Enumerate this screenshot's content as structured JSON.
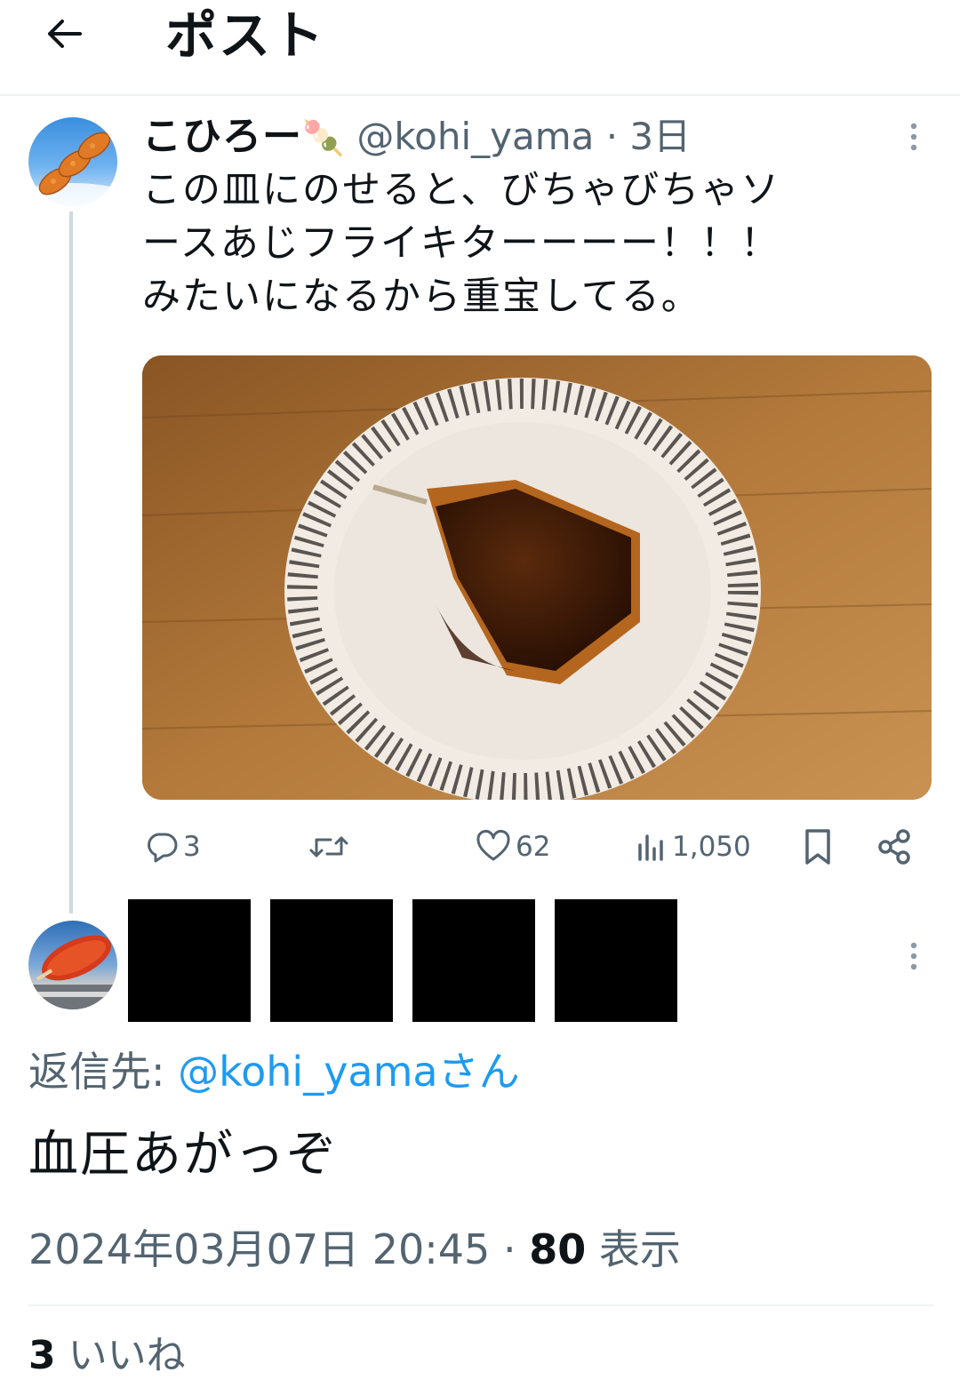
{
  "header": {
    "title": "ポスト"
  },
  "tweet": {
    "author_name": "こひろー",
    "author_emoji": "🍡",
    "handle_and_time": "@kohi_yama · 3日",
    "text_lines": [
      "この皿にのせると、びちゃびちゃソ",
      "ースあじフライキターーーー！！！",
      "みたいになるから重宝してる。"
    ],
    "actions": {
      "replies": "3",
      "likes": "62",
      "views": "1,050"
    }
  },
  "reply": {
    "reply_to_label": "返信先: ",
    "reply_to_handle": "@kohi_yamaさん",
    "text": "血圧あがっぞ",
    "timestamp": "2024年03月07日 20:45 · ",
    "views_count": "80",
    "views_label": " 表示",
    "likes_count": "3",
    "likes_label": " いいね"
  },
  "colors": {
    "accent": "#1d9bf0",
    "secondary_text": "#536471",
    "divider": "#eff3f4",
    "thread_line": "#cfd9de"
  }
}
